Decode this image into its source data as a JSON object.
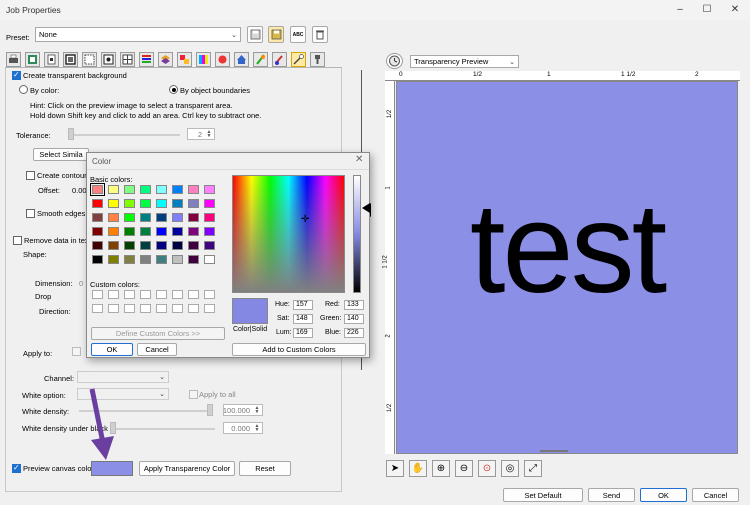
{
  "window": {
    "title": "Job Properties"
  },
  "preset": {
    "label": "Preset:",
    "value": "None"
  },
  "tools": {
    "abc_label": "ABC"
  },
  "panel": {
    "create_transparent_bg": "Create transparent background",
    "by_color": "By color:",
    "by_object_boundaries": "By object boundaries",
    "hint_line1": "Hint: Click on the preview image to select a transparent area.",
    "hint_line2": "Hold down Shift key and click to add an area. Ctrl key to subtract one.",
    "tolerance_label": "Tolerance:",
    "tolerance_value": "2",
    "select_similar": "Select Simila",
    "create_contour": "Create contour c",
    "offset_label": "Offset:",
    "offset_value": "0.00",
    "smooth_edges": "Smooth edges",
    "remove_data": "Remove data in text",
    "shape_label": "Shape:",
    "dimension_label": "Dimension:",
    "dimension_value": "0",
    "drop_label": "Drop",
    "direction_label": "Direction:",
    "apply_to_label": "Apply to:",
    "channel_label": "Channel:",
    "white_option_label": "White option:",
    "apply_to_all": "Apply to all",
    "white_density_label": "White density:",
    "white_density_value": "100.000",
    "white_density_under_label": "White density under black",
    "white_density_under_value": "0.000",
    "preview_canvas_color": "Preview canvas color",
    "canvas_color": "#8b8fe6",
    "apply_transparency_color": "Apply Transparency Color",
    "reset": "Reset"
  },
  "preview": {
    "mode": "Transparency Preview",
    "ruler_labels": [
      "0",
      "1/2",
      "1",
      "1 1/2",
      "2"
    ],
    "vruler_labels": [
      "1/2",
      "1",
      "1 1/2",
      "2",
      "1/2"
    ],
    "canvas_color": "#8b8fe6",
    "text": "test"
  },
  "color_dialog": {
    "title": "Color",
    "basic_colors_label": "Basic colors:",
    "basic_colors": [
      "#ff8080",
      "#ffff80",
      "#80ff80",
      "#00ff80",
      "#80ffff",
      "#0080ff",
      "#ff80c0",
      "#ff80ff",
      "#ff0000",
      "#ffff00",
      "#80ff00",
      "#00ff40",
      "#00ffff",
      "#0080c0",
      "#8080c0",
      "#ff00ff",
      "#804040",
      "#ff8040",
      "#00ff00",
      "#008080",
      "#004080",
      "#8080ff",
      "#800040",
      "#ff0080",
      "#800000",
      "#ff8000",
      "#008000",
      "#008040",
      "#0000ff",
      "#0000a0",
      "#800080",
      "#8000ff",
      "#400000",
      "#804000",
      "#004000",
      "#004040",
      "#000080",
      "#000040",
      "#400040",
      "#400080",
      "#000000",
      "#808000",
      "#808040",
      "#808080",
      "#408080",
      "#c0c0c0",
      "#400040",
      "#ffffff"
    ],
    "custom_colors_label": "Custom colors:",
    "define_custom": "Define Custom Colors >>",
    "ok": "OK",
    "cancel": "Cancel",
    "color_solid_label": "Color|Solid",
    "selected_color": "#8588e2",
    "hue_label": "Hue:",
    "hue": "157",
    "sat_label": "Sat:",
    "sat": "148",
    "lum_label": "Lum:",
    "lum": "169",
    "red_label": "Red:",
    "red": "133",
    "green_label": "Green:",
    "green": "140",
    "blue_label": "Blue:",
    "blue": "226",
    "add_to_custom": "Add to Custom Colors"
  },
  "footer": {
    "set_default": "Set Default",
    "send": "Send",
    "ok": "OK",
    "cancel": "Cancel"
  }
}
